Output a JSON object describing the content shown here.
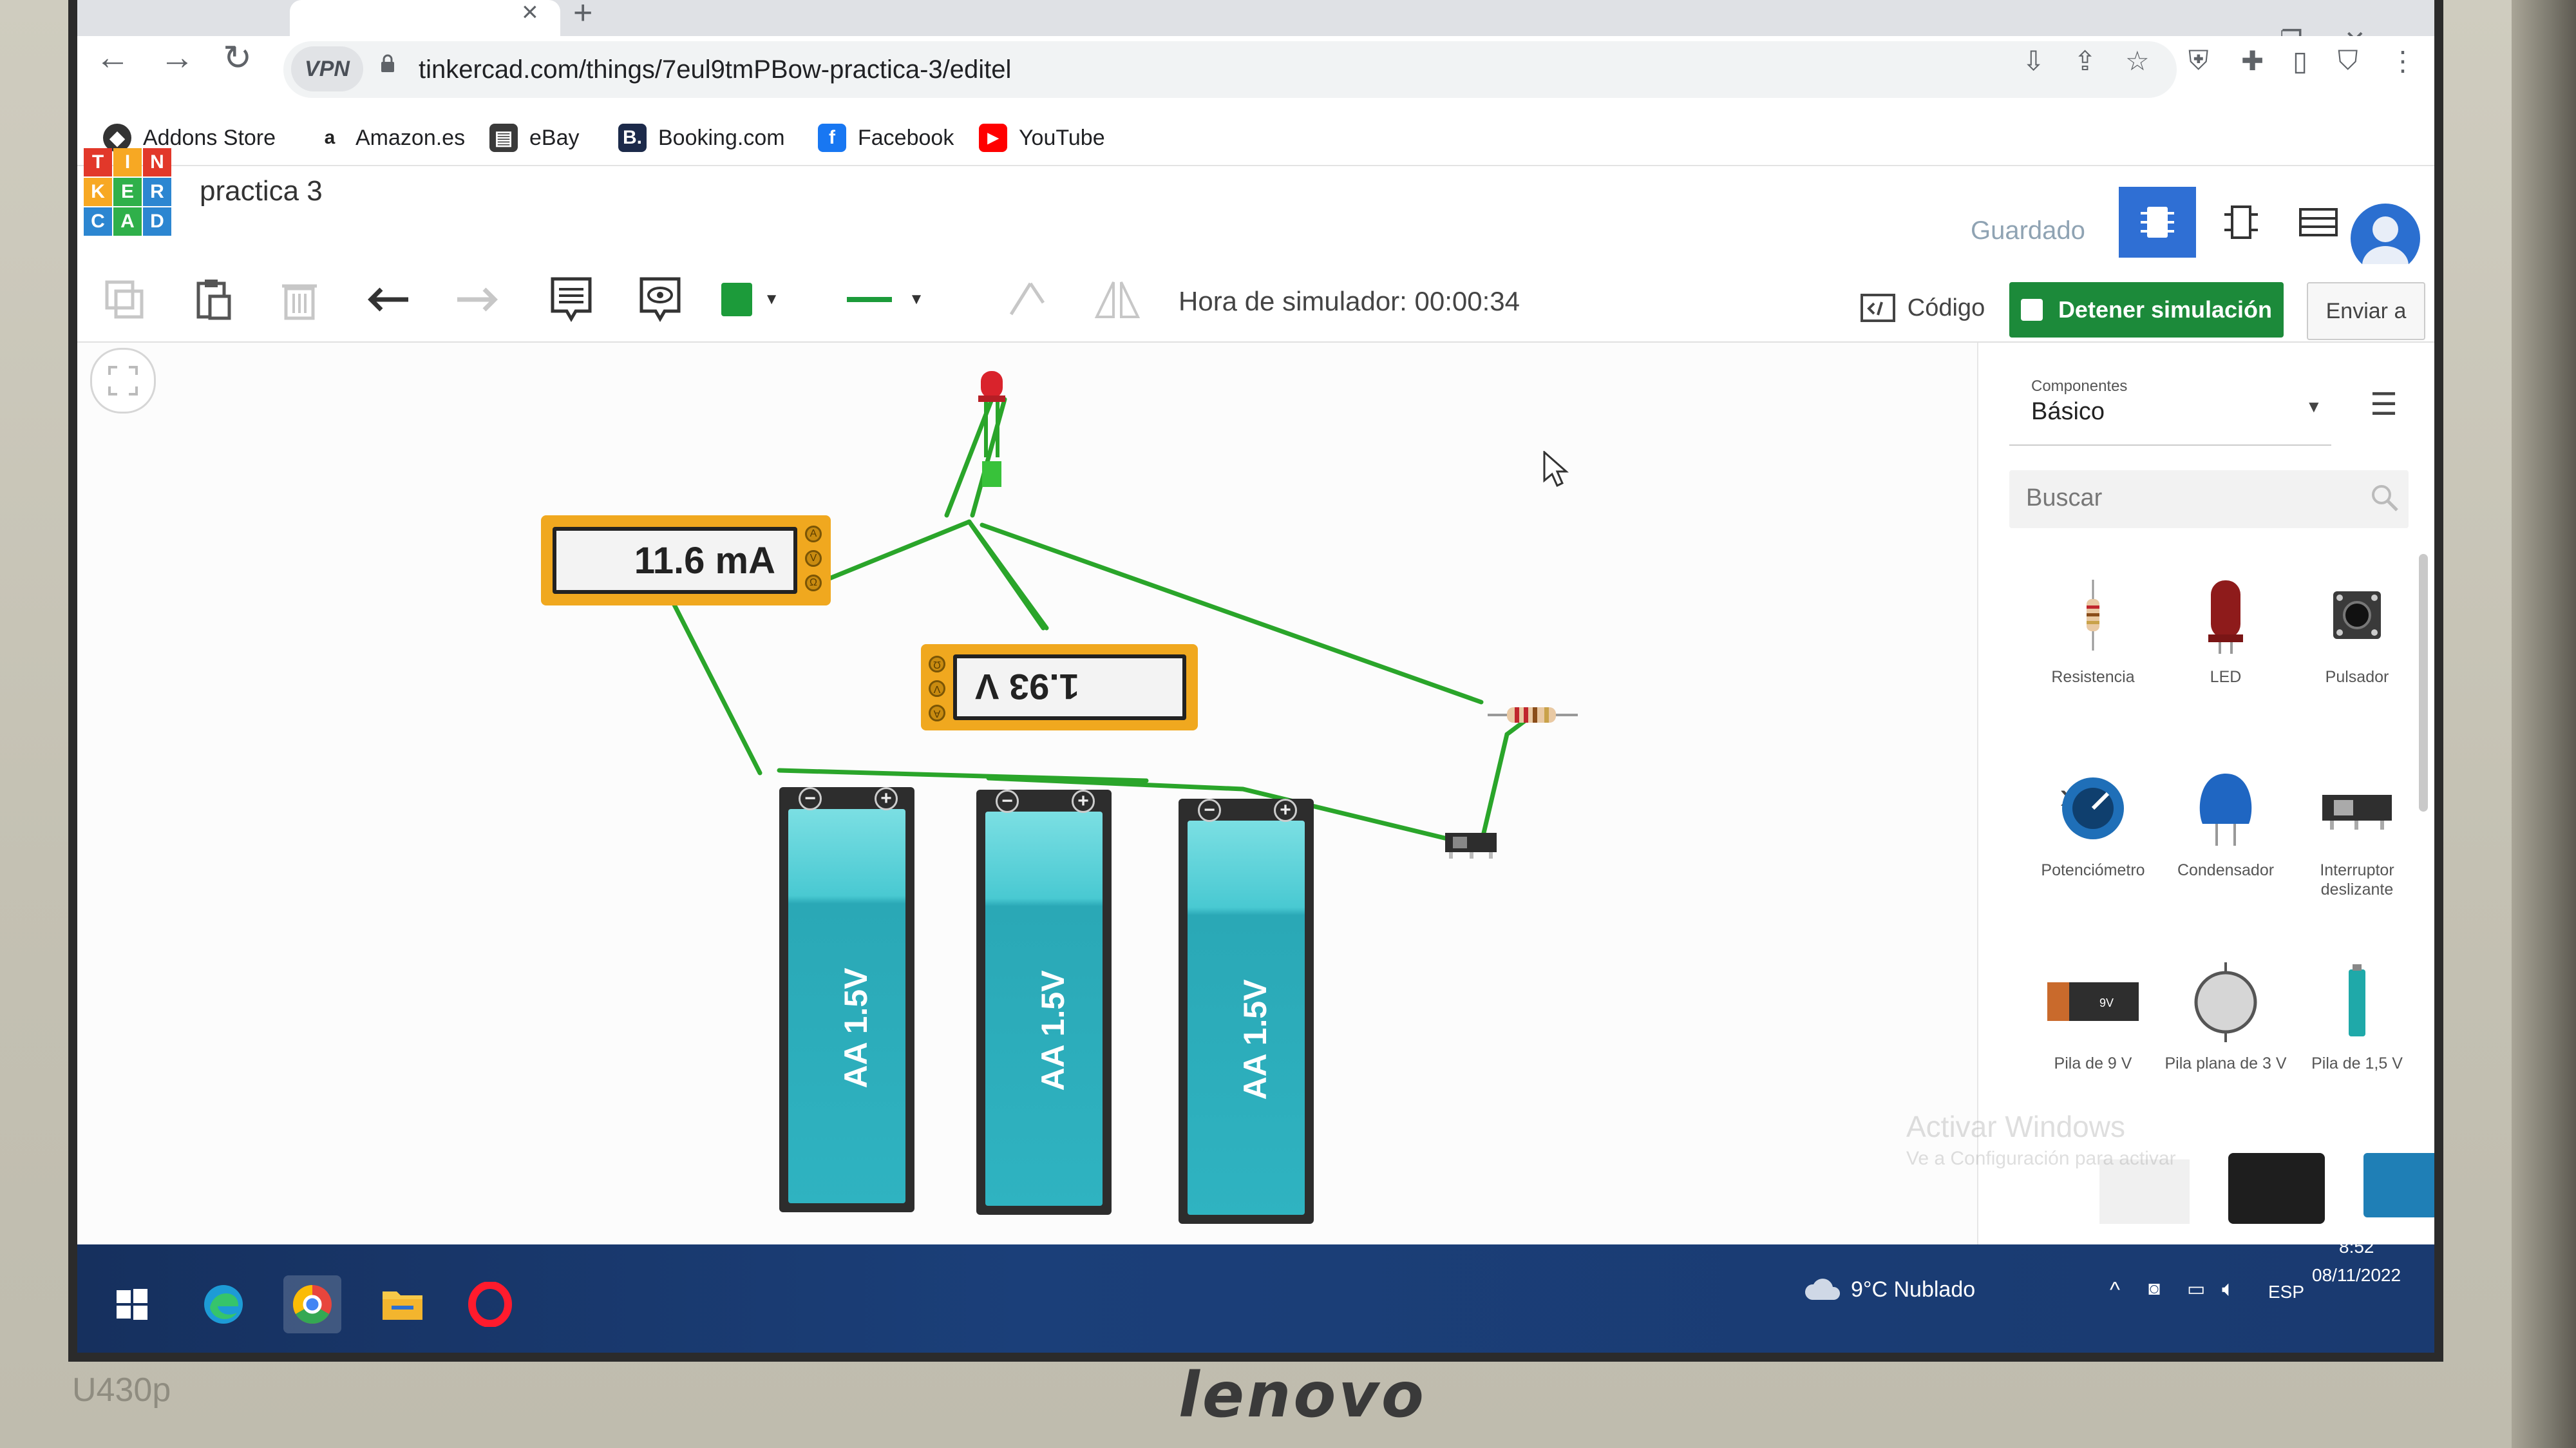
{
  "browser": {
    "url": "tinkercad.com/things/7eul9tmPBow-practica-3/editel",
    "vpn_label": "VPN",
    "bookmarks": [
      {
        "label": "Addons Store",
        "icon": "addons-icon",
        "color": "#333333"
      },
      {
        "label": "Amazon.es",
        "icon": "amazon-icon",
        "color": "#222222"
      },
      {
        "label": "eBay",
        "icon": "ebay-icon",
        "color": "#3a3a3a"
      },
      {
        "label": "Booking.com",
        "icon": "booking-icon",
        "color": "#1c2a4a"
      },
      {
        "label": "Facebook",
        "icon": "facebook-icon",
        "color": "#1877f2"
      },
      {
        "label": "YouTube",
        "icon": "youtube-icon",
        "color": "#ff0000"
      }
    ]
  },
  "app": {
    "logo_letters": [
      "T",
      "I",
      "N",
      "K",
      "E",
      "R",
      "C",
      "A",
      "D"
    ],
    "project_title": "practica 3",
    "saved_label": "Guardado"
  },
  "toolbar": {
    "sim_time": "Hora de simulador: 00:00:34",
    "code_label": "Código",
    "stop_label": "Detener simulación",
    "send_label": "Enviar a",
    "accent": "#1c8a3a",
    "wire_color": "#2aa52a"
  },
  "canvas": {
    "ammeter_reading": "11.6 mA",
    "voltmeter_reading": "1.93 V",
    "battery_label": "AA 1.5V",
    "battery_count": 3
  },
  "panel": {
    "dropdown_caption": "Componentes",
    "dropdown_value": "Básico",
    "search_placeholder": "Buscar",
    "components": [
      {
        "label": "Resistencia",
        "icon": "resistor-icon"
      },
      {
        "label": "LED",
        "icon": "led-icon"
      },
      {
        "label": "Pulsador",
        "icon": "pushbutton-icon"
      },
      {
        "label": "Potenciómetro",
        "icon": "potentiometer-icon"
      },
      {
        "label": "Condensador",
        "icon": "capacitor-icon"
      },
      {
        "label": "Interruptor deslizante",
        "icon": "slide-switch-icon"
      },
      {
        "label": "Pila de 9 V",
        "icon": "battery-9v-icon"
      },
      {
        "label": "Pila plana de 3 V",
        "icon": "coin-cell-icon"
      },
      {
        "label": "Pila de 1,5 V",
        "icon": "battery-aa-icon"
      }
    ],
    "watermark_title": "Activar Windows",
    "watermark_sub": "Ve a Configuración para activar"
  },
  "taskbar": {
    "weather": "9°C Nublado",
    "language": "ESP",
    "time": "8:52",
    "date": "08/11/2022"
  },
  "device": {
    "brand": "lenovo",
    "model": "U430p"
  }
}
